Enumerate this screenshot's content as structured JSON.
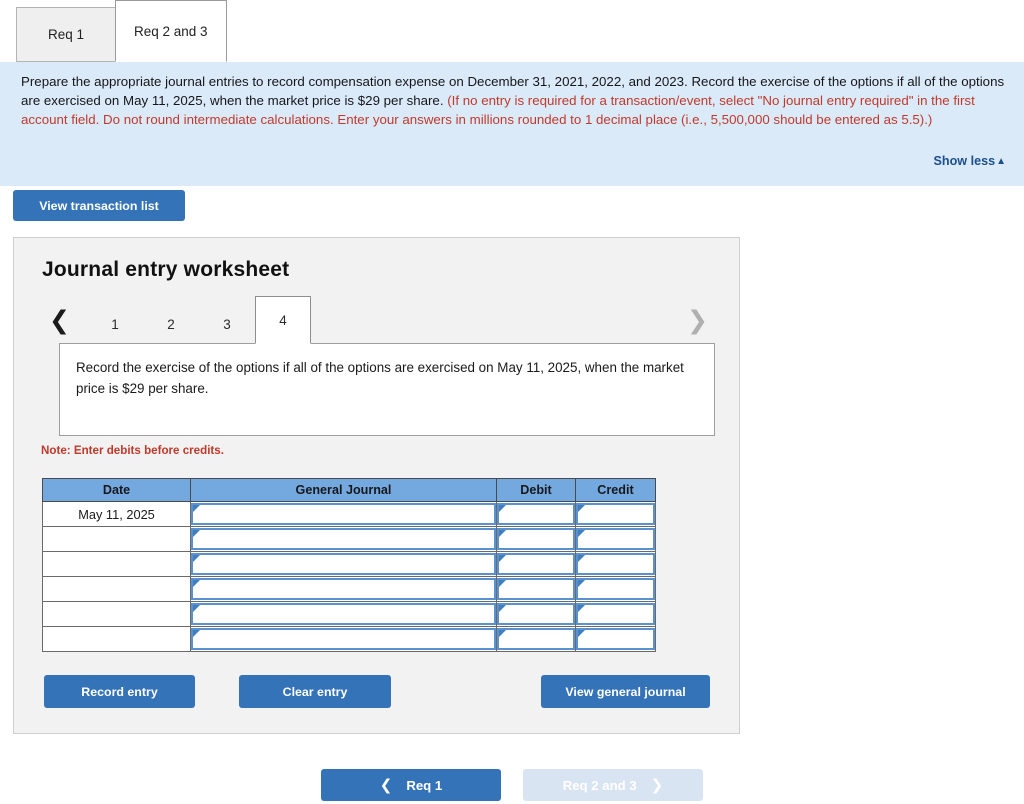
{
  "req_tabs": [
    {
      "label": "Req 1",
      "active": false
    },
    {
      "label": "Req 2 and 3",
      "active": true
    }
  ],
  "instruction": {
    "black_part": "Prepare the appropriate journal entries to record compensation expense on December 31, 2021, 2022, and 2023. Record the exercise of the options if all of the options are exercised on May 11, 2025, when the market price is $29 per share. ",
    "red_part": "(If no entry is required for a transaction/event, select \"No journal entry required\" in the first account field. Do not round intermediate calculations. Enter your answers in millions rounded to 1 decimal place (i.e., 5,500,000 should be entered as 5.5).)",
    "show_less_label": "Show less",
    "show_less_caret": "▲",
    "background_color": "#dbeaf9",
    "red_color": "#c0392b"
  },
  "toolbar": {
    "view_transaction_list_label": "View transaction list"
  },
  "worksheet": {
    "title": "Journal entry worksheet",
    "pager": {
      "prev_arrow": "❮",
      "next_arrow": "❯",
      "pages": [
        "1",
        "2",
        "3",
        "4"
      ],
      "active_page": "4"
    },
    "description": "Record the exercise of the options if all of the options are exercised on May 11, 2025, when the market price is $29 per share.",
    "note": "Note: Enter debits before credits.",
    "table": {
      "headers": [
        "Date",
        "General Journal",
        "Debit",
        "Credit"
      ],
      "rows": [
        {
          "date": "May 11, 2025",
          "general_journal": "",
          "debit": "",
          "credit": ""
        },
        {
          "date": "",
          "general_journal": "",
          "debit": "",
          "credit": ""
        },
        {
          "date": "",
          "general_journal": "",
          "debit": "",
          "credit": ""
        },
        {
          "date": "",
          "general_journal": "",
          "debit": "",
          "credit": ""
        },
        {
          "date": "",
          "general_journal": "",
          "debit": "",
          "credit": ""
        },
        {
          "date": "",
          "general_journal": "",
          "debit": "",
          "credit": ""
        }
      ],
      "header_color": "#74a9e0"
    },
    "actions": {
      "record_entry_label": "Record entry",
      "clear_entry_label": "Clear entry",
      "view_general_journal_label": "View general journal"
    }
  },
  "bottom_nav": {
    "prev_label": "Req 1",
    "prev_chevron": "❮",
    "next_label": "Req 2 and 3",
    "next_chevron": "❯",
    "accent_color": "#3573b9",
    "disabled_color": "#d8e4f1"
  }
}
